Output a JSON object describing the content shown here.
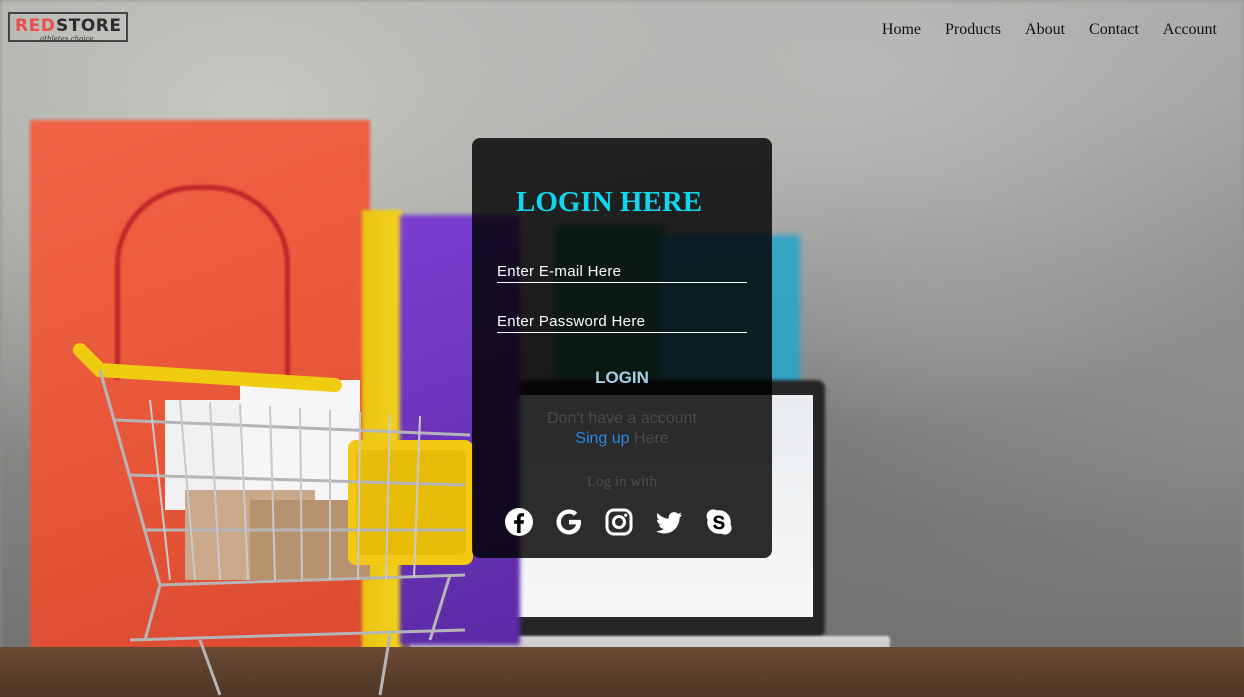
{
  "brand": {
    "name_red": "RED",
    "name_dark": "STORE",
    "tagline": "athletes choice",
    "accent_color": "#e8504a"
  },
  "nav": {
    "items": [
      "Home",
      "Products",
      "About",
      "Contact",
      "Account"
    ]
  },
  "login": {
    "title": "LOGIN HERE",
    "title_color": "#0fd7ee",
    "email_placeholder": "Enter E-mail Here",
    "password_placeholder": "Enter Password Here",
    "login_label": "LOGIN",
    "no_account_text": "Don't have a account",
    "signup_link": "Sing up",
    "signup_suffix": " Here",
    "login_with": "Log in with",
    "socials": [
      "facebook-icon",
      "google-icon",
      "instagram-icon",
      "twitter-icon",
      "skype-icon"
    ]
  }
}
